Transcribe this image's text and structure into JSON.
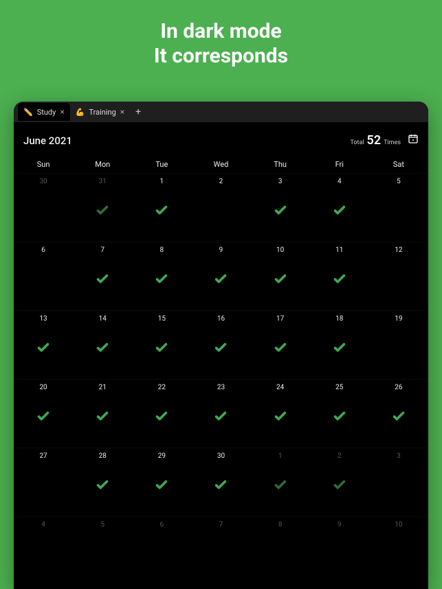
{
  "hero": {
    "line1": "In dark mode",
    "line2": "It corresponds"
  },
  "tabs": [
    {
      "emoji": "✏️",
      "label": "Study",
      "active": true
    },
    {
      "emoji": "💪",
      "label": "Training",
      "active": false
    }
  ],
  "month": "June 2021",
  "stats": {
    "total_label": "Total",
    "count": "52",
    "unit": "Times"
  },
  "day_headers": [
    "Sun",
    "Mon",
    "Tue",
    "Wed",
    "Thu",
    "Fri",
    "Sat"
  ],
  "cells": [
    {
      "n": "30",
      "dim": true,
      "check": false,
      "checkDim": false
    },
    {
      "n": "31",
      "dim": true,
      "check": true,
      "checkDim": true
    },
    {
      "n": "1",
      "dim": false,
      "check": true,
      "checkDim": false
    },
    {
      "n": "2",
      "dim": false,
      "check": false,
      "checkDim": false
    },
    {
      "n": "3",
      "dim": false,
      "check": true,
      "checkDim": false
    },
    {
      "n": "4",
      "dim": false,
      "check": true,
      "checkDim": false
    },
    {
      "n": "5",
      "dim": false,
      "check": false,
      "checkDim": false
    },
    {
      "n": "6",
      "dim": false,
      "check": false,
      "checkDim": false
    },
    {
      "n": "7",
      "dim": false,
      "check": true,
      "checkDim": false
    },
    {
      "n": "8",
      "dim": false,
      "check": true,
      "checkDim": false
    },
    {
      "n": "9",
      "dim": false,
      "check": true,
      "checkDim": false
    },
    {
      "n": "10",
      "dim": false,
      "check": true,
      "checkDim": false
    },
    {
      "n": "11",
      "dim": false,
      "check": true,
      "checkDim": false
    },
    {
      "n": "12",
      "dim": false,
      "check": false,
      "checkDim": false
    },
    {
      "n": "13",
      "dim": false,
      "check": true,
      "checkDim": false
    },
    {
      "n": "14",
      "dim": false,
      "check": true,
      "checkDim": false
    },
    {
      "n": "15",
      "dim": false,
      "check": true,
      "checkDim": false
    },
    {
      "n": "16",
      "dim": false,
      "check": true,
      "checkDim": false
    },
    {
      "n": "17",
      "dim": false,
      "check": true,
      "checkDim": false
    },
    {
      "n": "18",
      "dim": false,
      "check": true,
      "checkDim": false
    },
    {
      "n": "19",
      "dim": false,
      "check": false,
      "checkDim": false
    },
    {
      "n": "20",
      "dim": false,
      "check": true,
      "checkDim": false
    },
    {
      "n": "21",
      "dim": false,
      "check": true,
      "checkDim": false
    },
    {
      "n": "22",
      "dim": false,
      "check": true,
      "checkDim": false
    },
    {
      "n": "23",
      "dim": false,
      "check": true,
      "checkDim": false
    },
    {
      "n": "24",
      "dim": false,
      "check": true,
      "checkDim": false
    },
    {
      "n": "25",
      "dim": false,
      "check": true,
      "checkDim": false
    },
    {
      "n": "26",
      "dim": false,
      "check": true,
      "checkDim": false
    },
    {
      "n": "27",
      "dim": false,
      "check": false,
      "checkDim": false
    },
    {
      "n": "28",
      "dim": false,
      "check": true,
      "checkDim": false
    },
    {
      "n": "29",
      "dim": false,
      "check": true,
      "checkDim": false
    },
    {
      "n": "30",
      "dim": false,
      "check": true,
      "checkDim": false
    },
    {
      "n": "1",
      "dim": true,
      "check": true,
      "checkDim": true
    },
    {
      "n": "2",
      "dim": true,
      "check": true,
      "checkDim": true
    },
    {
      "n": "3",
      "dim": true,
      "check": false,
      "checkDim": false
    },
    {
      "n": "4",
      "dim": true,
      "check": false,
      "checkDim": false
    },
    {
      "n": "5",
      "dim": true,
      "check": false,
      "checkDim": false
    },
    {
      "n": "6",
      "dim": true,
      "check": false,
      "checkDim": false
    },
    {
      "n": "7",
      "dim": true,
      "check": false,
      "checkDim": false
    },
    {
      "n": "8",
      "dim": true,
      "check": false,
      "checkDim": false
    },
    {
      "n": "9",
      "dim": true,
      "check": false,
      "checkDim": false
    },
    {
      "n": "10",
      "dim": true,
      "check": false,
      "checkDim": false
    }
  ]
}
